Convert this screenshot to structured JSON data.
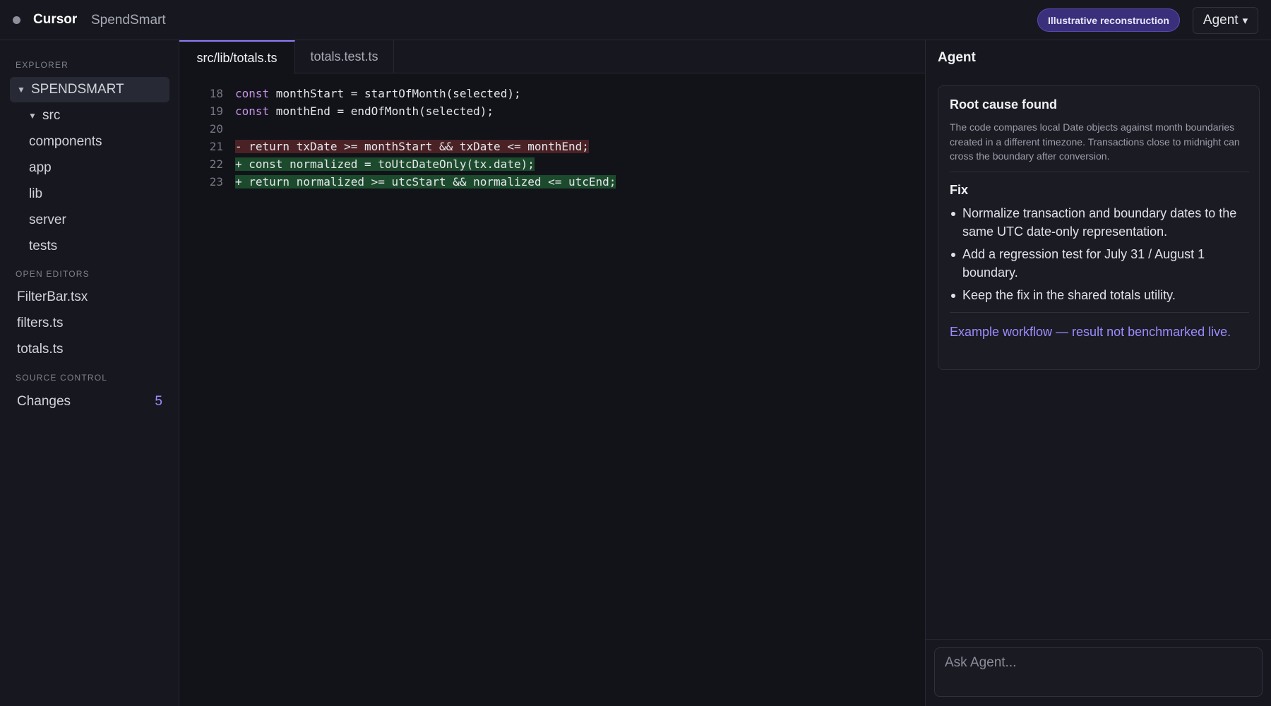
{
  "titlebar": {
    "app_name": "Cursor",
    "project_name": "SpendSmart",
    "badge": "Illustrative reconstruction",
    "agent_button": "Agent",
    "agent_button_chevron": "▾"
  },
  "sidebar": {
    "explorer_label": "EXPLORER",
    "root_folder": "SPENDSMART",
    "tree": [
      {
        "label": "src",
        "expanded": true
      },
      {
        "label": "components"
      },
      {
        "label": "app"
      },
      {
        "label": "lib"
      },
      {
        "label": "server"
      },
      {
        "label": "tests"
      }
    ],
    "open_editors_label": "OPEN EDITORS",
    "open_editors": [
      "FilterBar.tsx",
      "filters.ts",
      "totals.ts"
    ],
    "source_control_label": "SOURCE CONTROL",
    "changes_label": "Changes",
    "changes_count": "5"
  },
  "editor": {
    "tabs": [
      {
        "label": "src/lib/totals.ts",
        "active": true
      },
      {
        "label": "totals.test.ts",
        "active": false
      }
    ],
    "lines": [
      {
        "num": "18",
        "kw": "const",
        "rest": " monthStart = startOfMonth(selected);",
        "type": "normal"
      },
      {
        "num": "19",
        "kw": "const",
        "rest": " monthEnd = endOfMonth(selected);",
        "type": "normal"
      },
      {
        "num": "20",
        "kw": "",
        "rest": "",
        "type": "normal"
      },
      {
        "num": "21",
        "kw": "",
        "rest": "- return txDate >= monthStart && txDate <= monthEnd;",
        "type": "del"
      },
      {
        "num": "22",
        "kw": "",
        "rest": "+ const normalized = toUtcDateOnly(tx.date);",
        "type": "add"
      },
      {
        "num": "23",
        "kw": "",
        "rest": "+ return normalized >= utcStart && normalized <= utcEnd;",
        "type": "add"
      }
    ]
  },
  "agent": {
    "title": "Agent",
    "card": {
      "root_cause_title": "Root cause found",
      "root_cause_text": "The code compares local Date objects against month boundaries created in a different timezone. Transactions close to midnight can cross the boundary after conversion.",
      "fix_title": "Fix",
      "fix_items": [
        "Normalize transaction and boundary dates to the same UTC date-only representation.",
        "Add a regression test for July 31 / August 1 boundary.",
        "Keep the fix in the shared totals utility."
      ],
      "note": "Example workflow — result not benchmarked live."
    },
    "input_placeholder": "Ask Agent..."
  },
  "colors": {
    "accent": "#8b7cf6",
    "badge_bg": "#3a2f7a",
    "diff_deleted_bg": "#4a2226",
    "diff_added_bg": "#1c4a2c",
    "keyword": "#c792ea"
  }
}
